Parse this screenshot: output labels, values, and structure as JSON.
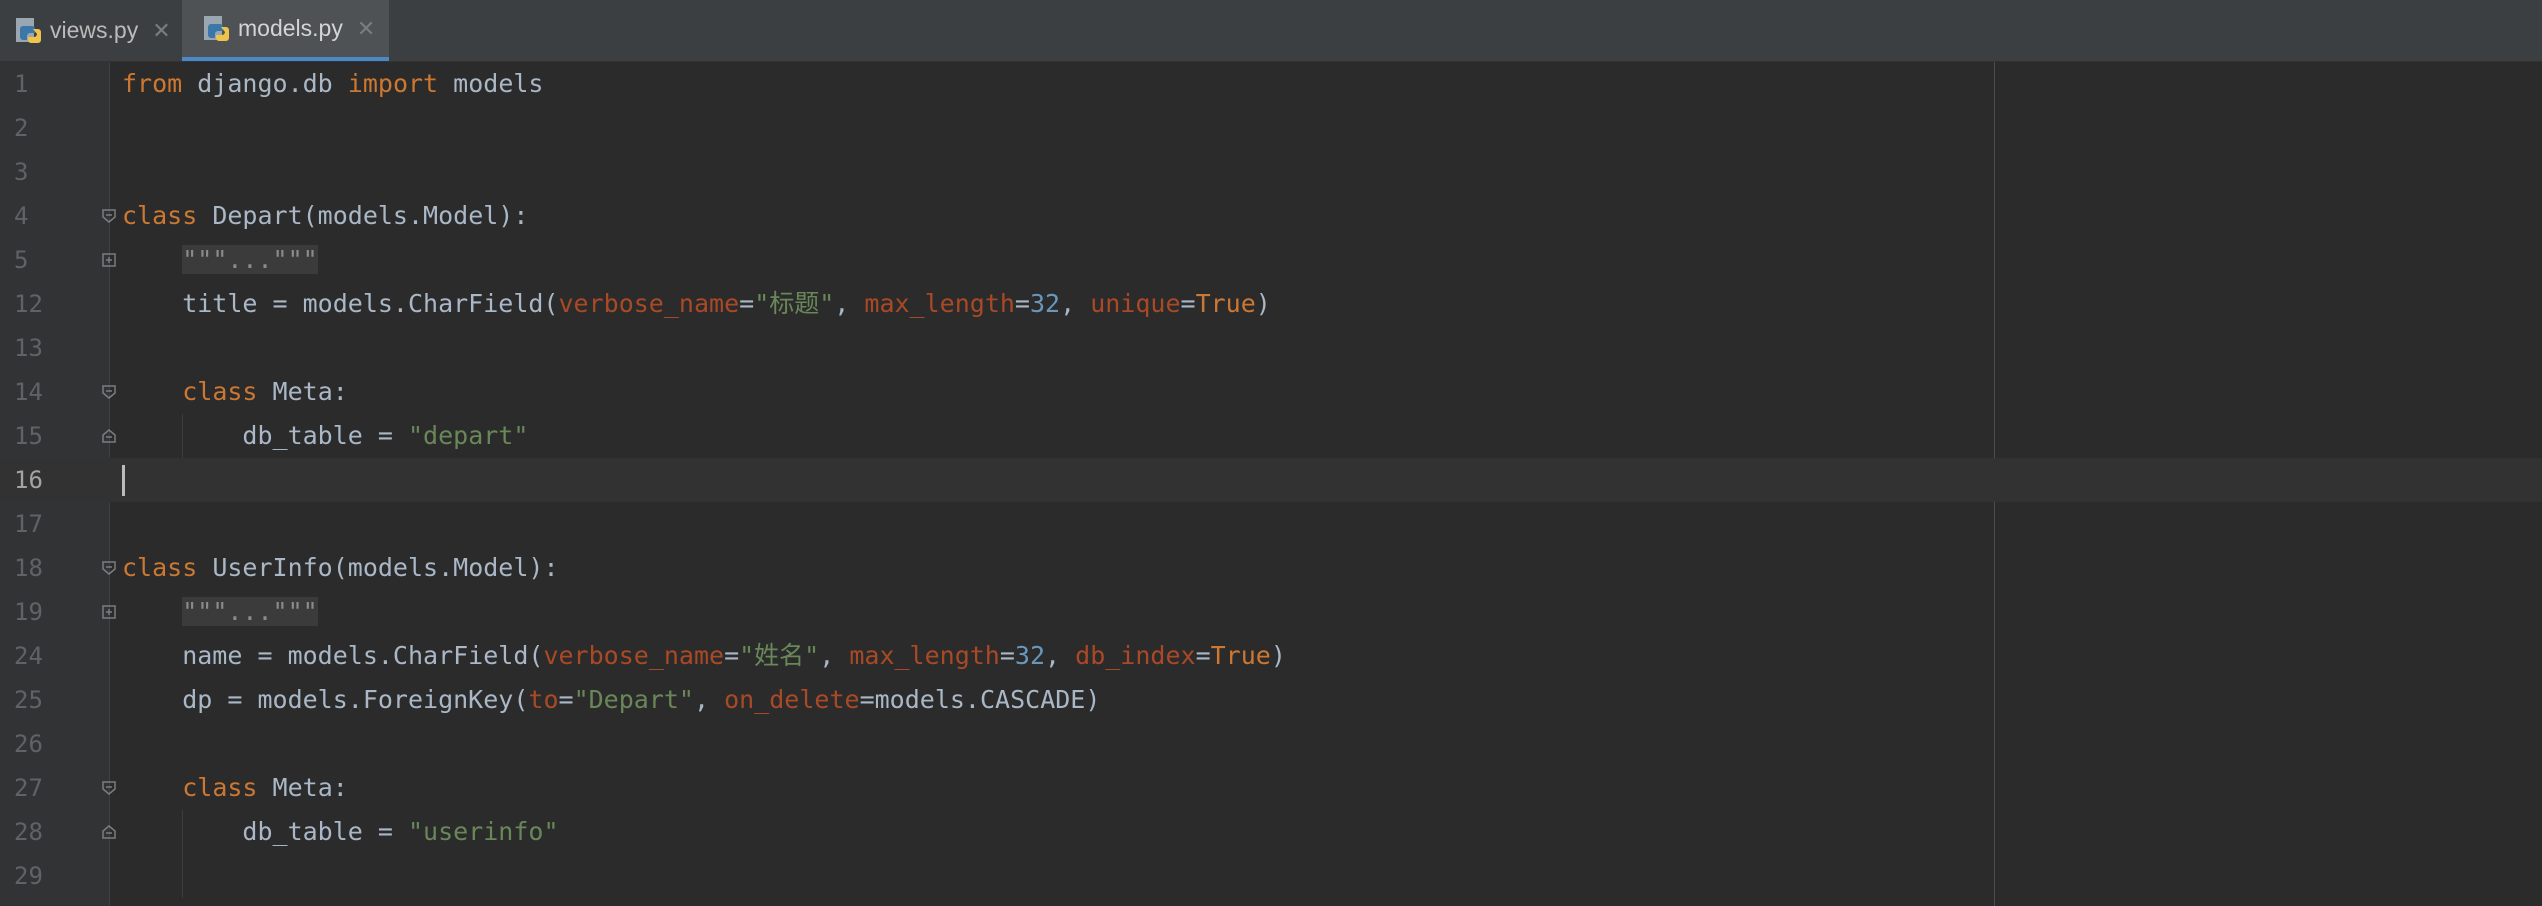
{
  "tabs": [
    {
      "label": "views.py",
      "icon": "python-file-icon",
      "active": false
    },
    {
      "label": "models.py",
      "icon": "python-file-icon",
      "active": true
    }
  ],
  "colors": {
    "background": "#2b2b2b",
    "keyword": "#cc7832",
    "string": "#6a8759",
    "number": "#6897bb",
    "parameter": "#aa4926",
    "text": "#a9b7c6",
    "tab_accent": "#4a88c7"
  },
  "editor": {
    "current_line": "16",
    "lines": [
      {
        "num": "1",
        "t": [
          "from",
          " django.db ",
          "import",
          " models"
        ]
      },
      {
        "num": "2",
        "t": []
      },
      {
        "num": "3",
        "t": []
      },
      {
        "num": "4",
        "t": [
          "class",
          " Depart(models.Model):"
        ]
      },
      {
        "num": "5",
        "t": [
          "    ",
          "\"\"\"...\"\"\""
        ]
      },
      {
        "num": "12",
        "t": [
          "    title = models.CharField(",
          "verbose_name",
          "=",
          "\"标题\"",
          ", ",
          "max_length",
          "=",
          "32",
          ", ",
          "unique",
          "=",
          "True",
          ")"
        ]
      },
      {
        "num": "13",
        "t": []
      },
      {
        "num": "14",
        "t": [
          "    ",
          "class",
          " Meta:"
        ]
      },
      {
        "num": "15",
        "t": [
          "        db_table = ",
          "\"depart\""
        ]
      },
      {
        "num": "16",
        "t": []
      },
      {
        "num": "17",
        "t": []
      },
      {
        "num": "18",
        "t": [
          "class",
          " UserInfo(models.Model):"
        ]
      },
      {
        "num": "19",
        "t": [
          "    ",
          "\"\"\"...\"\"\""
        ]
      },
      {
        "num": "24",
        "t": [
          "    name = models.CharField(",
          "verbose_name",
          "=",
          "\"姓名\"",
          ", ",
          "max_length",
          "=",
          "32",
          ", ",
          "db_index",
          "=",
          "True",
          ")"
        ]
      },
      {
        "num": "25",
        "t": [
          "    dp = models.ForeignKey(",
          "to",
          "=",
          "\"Depart\"",
          ", ",
          "on_delete",
          "=",
          "models.CASCADE)"
        ]
      },
      {
        "num": "26",
        "t": []
      },
      {
        "num": "27",
        "t": [
          "    ",
          "class",
          " Meta:"
        ]
      },
      {
        "num": "28",
        "t": [
          "        db_table = ",
          "\"userinfo\""
        ]
      },
      {
        "num": "29",
        "t": []
      }
    ]
  }
}
